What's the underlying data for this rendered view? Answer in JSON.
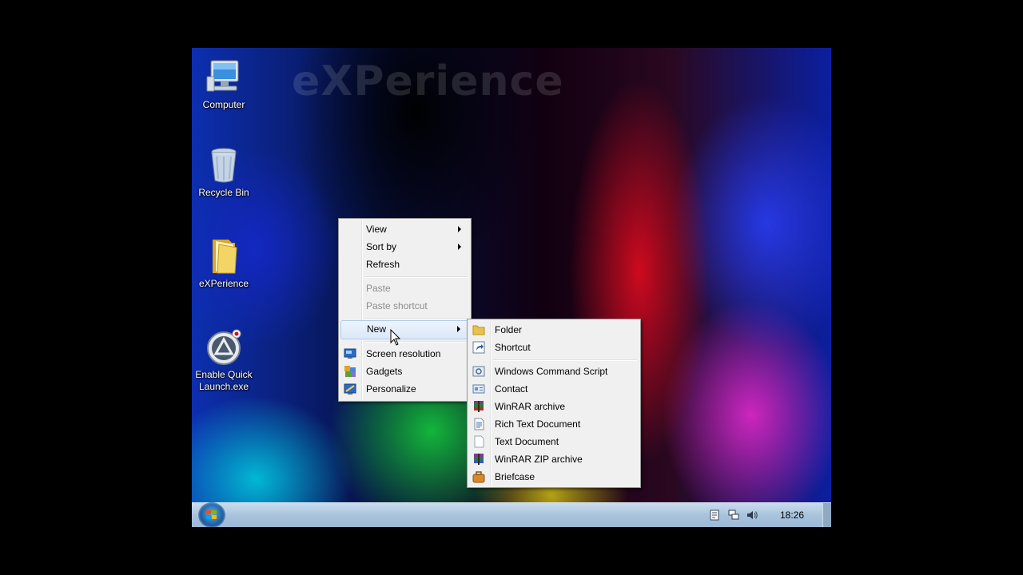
{
  "watermark": "eXPerience",
  "desktop_icons": [
    {
      "label": "Computer",
      "icon": "computer-icon"
    },
    {
      "label": "Recycle Bin",
      "icon": "recycle-bin-icon"
    },
    {
      "label": "eXPerience",
      "icon": "folder-icon"
    },
    {
      "label": "Enable Quick Launch.exe",
      "icon": "app-icon"
    }
  ],
  "context_menu": {
    "items": [
      {
        "label": "View",
        "submenu": true
      },
      {
        "label": "Sort by",
        "submenu": true
      },
      {
        "label": "Refresh"
      },
      {
        "label": "Paste",
        "disabled": true
      },
      {
        "label": "Paste shortcut",
        "disabled": true
      },
      {
        "label": "New",
        "submenu": true,
        "highlighted": true
      },
      {
        "label": "Screen resolution",
        "icon": "screen-resolution-icon"
      },
      {
        "label": "Gadgets",
        "icon": "gadgets-icon"
      },
      {
        "label": "Personalize",
        "icon": "personalize-icon"
      }
    ]
  },
  "new_submenu": {
    "items": [
      {
        "label": "Folder",
        "icon": "folder-icon"
      },
      {
        "label": "Shortcut",
        "icon": "shortcut-icon"
      },
      {
        "label": "Windows Command Script",
        "icon": "command-script-icon"
      },
      {
        "label": "Contact",
        "icon": "contact-icon"
      },
      {
        "label": "WinRAR archive",
        "icon": "winrar-icon"
      },
      {
        "label": "Rich Text Document",
        "icon": "rich-text-icon"
      },
      {
        "label": "Text Document",
        "icon": "text-document-icon"
      },
      {
        "label": "WinRAR ZIP archive",
        "icon": "winrar-zip-icon"
      },
      {
        "label": "Briefcase",
        "icon": "briefcase-icon"
      }
    ]
  },
  "taskbar": {
    "clock": "18:26",
    "tray_icons": [
      "action-center-icon",
      "network-icon",
      "volume-icon"
    ]
  },
  "colors": {
    "menu_bg": "#f0f0f0",
    "menu_highlight": "#dbe8f9",
    "taskbar": "#b3cbe2"
  }
}
